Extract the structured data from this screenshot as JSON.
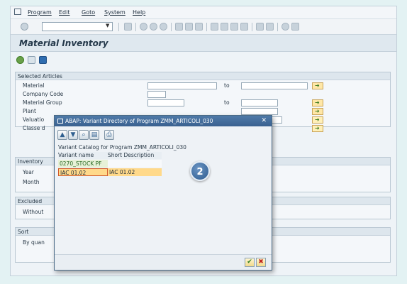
{
  "menu": {
    "items": [
      "Program",
      "Edit",
      "Goto",
      "System",
      "Help"
    ]
  },
  "title": "Material Inventory",
  "selected_articles": {
    "header": "Selected Articles",
    "fields": [
      {
        "label": "Material",
        "has_to": true
      },
      {
        "label": "Company Code",
        "has_to": false
      },
      {
        "label": "Material Group",
        "has_to": true
      },
      {
        "label": "Plant",
        "has_to": false
      },
      {
        "label": "Valuatio",
        "has_to": false
      },
      {
        "label": "Classe d",
        "has_to": false
      }
    ],
    "to_label": "to"
  },
  "inventory": {
    "header": "Inventory",
    "fields": [
      "Year",
      "Month"
    ]
  },
  "excluded": {
    "header": "Excluded",
    "fields": [
      "Without"
    ]
  },
  "sort": {
    "header": "Sort",
    "fields": [
      "By quan"
    ]
  },
  "dialog": {
    "title": "ABAP: Variant Directory of Program ZMM_ARTICOLI_030",
    "close": "✕",
    "catalog_label": "Variant Catalog for Program ZMM_ARTICOLI_030",
    "columns": [
      "Variant name",
      "Short Description"
    ],
    "rows": [
      {
        "name": "0270_STOCK PF",
        "desc": ""
      },
      {
        "name": "IAC 01.02",
        "desc": "IAC 01.02"
      }
    ],
    "ok": "✔",
    "cancel": "✖"
  },
  "step_badge": "2",
  "colors": {
    "accent": "#3a6190",
    "selected_row": "#ffd98a",
    "first_row": "#e7f1d7"
  }
}
